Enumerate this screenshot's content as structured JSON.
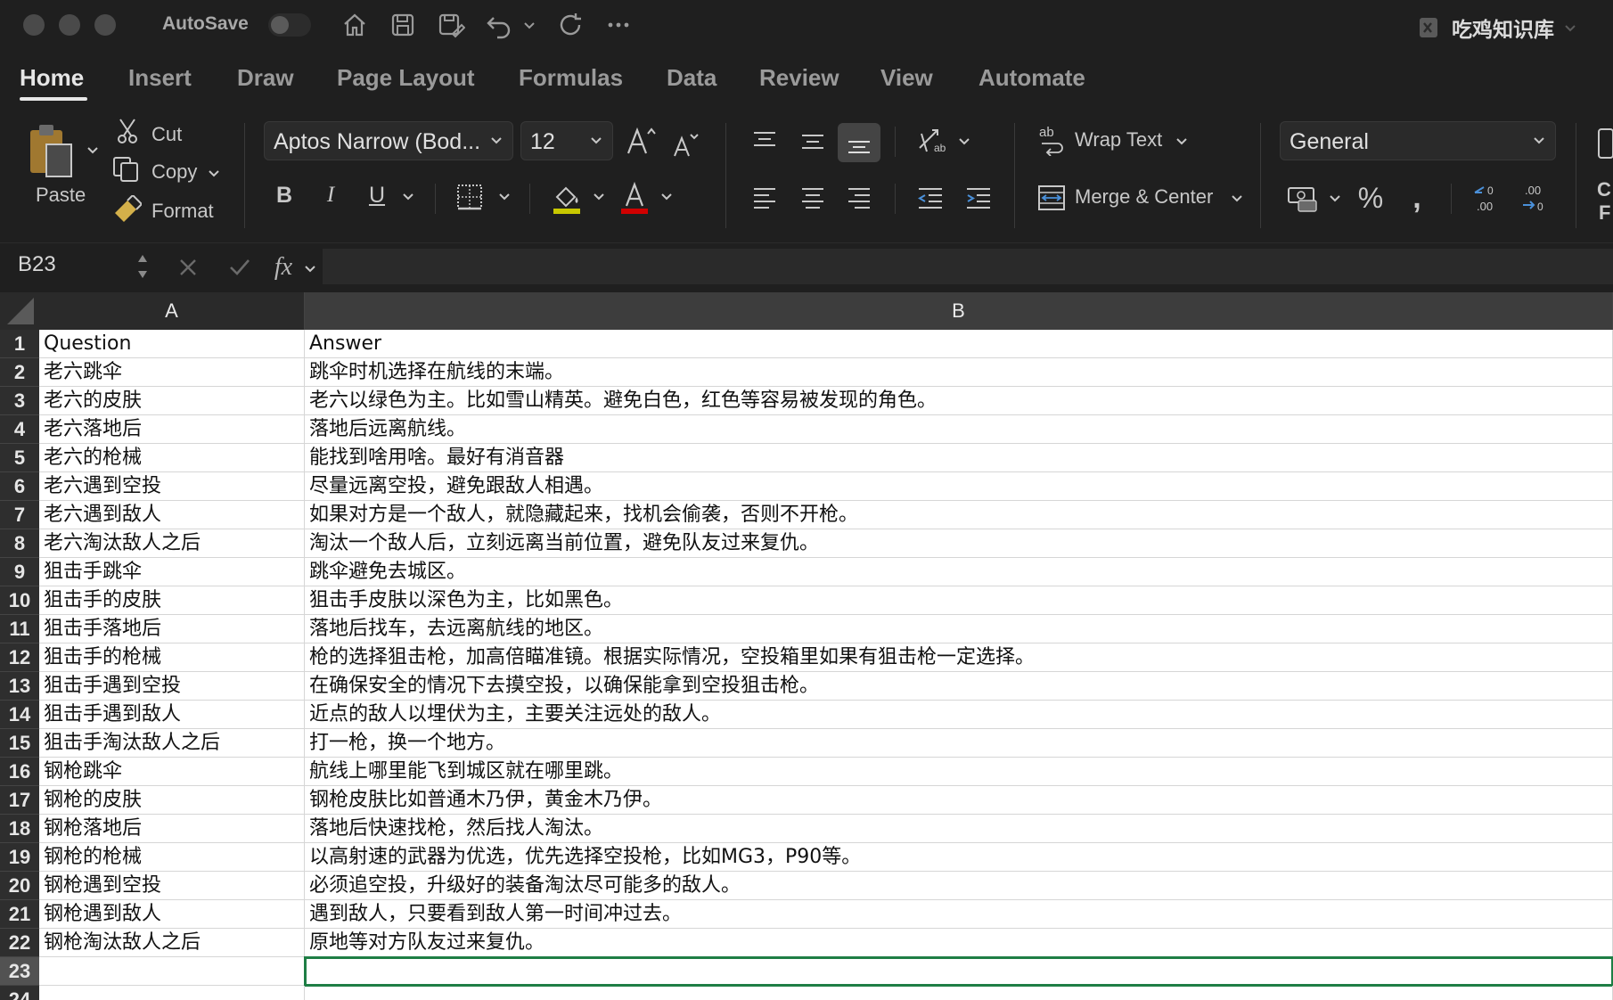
{
  "window": {
    "autosave_label": "AutoSave",
    "document_title": "吃鸡知识库"
  },
  "tabs": [
    "Home",
    "Insert",
    "Draw",
    "Page Layout",
    "Formulas",
    "Data",
    "Review",
    "View",
    "Automate"
  ],
  "ribbon": {
    "paste_label": "Paste",
    "cut_label": "Cut",
    "copy_label": "Copy",
    "format_label": "Format",
    "font_name": "Aptos Narrow (Bod...",
    "font_size": "12",
    "wrap_text_label": "Wrap Text",
    "merge_center_label": "Merge & Center",
    "number_format": "General",
    "highlight_color": "#c8c800",
    "font_color": "#d00000",
    "right_edge_labels": [
      "C",
      "F"
    ]
  },
  "formula_bar": {
    "name_box": "B23",
    "formula": ""
  },
  "sheet": {
    "columns": [
      "A",
      "B"
    ],
    "selected_column": "B",
    "selected_row": 23,
    "rows": [
      {
        "num": "1",
        "a": "Question",
        "b": "Answer"
      },
      {
        "num": "2",
        "a": "老六跳伞",
        "b": "跳伞时机选择在航线的末端。"
      },
      {
        "num": "3",
        "a": "老六的皮肤",
        "b": "老六以绿色为主。比如雪山精英。避免白色，红色等容易被发现的角色。"
      },
      {
        "num": "4",
        "a": "老六落地后",
        "b": "落地后远离航线。"
      },
      {
        "num": "5",
        "a": "老六的枪械",
        "b": "能找到啥用啥。最好有消音器"
      },
      {
        "num": "6",
        "a": "老六遇到空投",
        "b": "尽量远离空投，避免跟敌人相遇。"
      },
      {
        "num": "7",
        "a": "老六遇到敌人",
        "b": "如果对方是一个敌人，就隐藏起来，找机会偷袭，否则不开枪。"
      },
      {
        "num": "8",
        "a": "老六淘汰敌人之后",
        "b": "淘汰一个敌人后，立刻远离当前位置，避免队友过来复仇。"
      },
      {
        "num": "9",
        "a": "狙击手跳伞",
        "b": "跳伞避免去城区。"
      },
      {
        "num": "10",
        "a": "狙击手的皮肤",
        "b": "狙击手皮肤以深色为主，比如黑色。"
      },
      {
        "num": "11",
        "a": "狙击手落地后",
        "b": "落地后找车，去远离航线的地区。"
      },
      {
        "num": "12",
        "a": "狙击手的枪械",
        "b": "枪的选择狙击枪，加高倍瞄准镜。根据实际情况，空投箱里如果有狙击枪一定选择。"
      },
      {
        "num": "13",
        "a": "狙击手遇到空投",
        "b": "在确保安全的情况下去摸空投，以确保能拿到空投狙击枪。"
      },
      {
        "num": "14",
        "a": "狙击手遇到敌人",
        "b": "近点的敌人以埋伏为主，主要关注远处的敌人。"
      },
      {
        "num": "15",
        "a": "狙击手淘汰敌人之后",
        "b": "打一枪，换一个地方。"
      },
      {
        "num": "16",
        "a": "钢枪跳伞",
        "b": "航线上哪里能飞到城区就在哪里跳。"
      },
      {
        "num": "17",
        "a": "钢枪的皮肤",
        "b": "钢枪皮肤比如普通木乃伊，黄金木乃伊。"
      },
      {
        "num": "18",
        "a": "钢枪落地后",
        "b": "落地后快速找枪，然后找人淘汰。"
      },
      {
        "num": "19",
        "a": "钢枪的枪械",
        "b": "以高射速的武器为优选，优先选择空投枪，比如MG3，P90等。"
      },
      {
        "num": "20",
        "a": "钢枪遇到空投",
        "b": "必须追空投，升级好的装备淘汰尽可能多的敌人。"
      },
      {
        "num": "21",
        "a": "钢枪遇到敌人",
        "b": "遇到敌人，只要看到敌人第一时间冲过去。"
      },
      {
        "num": "22",
        "a": "钢枪淘汰敌人之后",
        "b": "原地等对方队友过来复仇。"
      },
      {
        "num": "23",
        "a": "",
        "b": ""
      },
      {
        "num": "24",
        "a": "",
        "b": ""
      }
    ]
  }
}
